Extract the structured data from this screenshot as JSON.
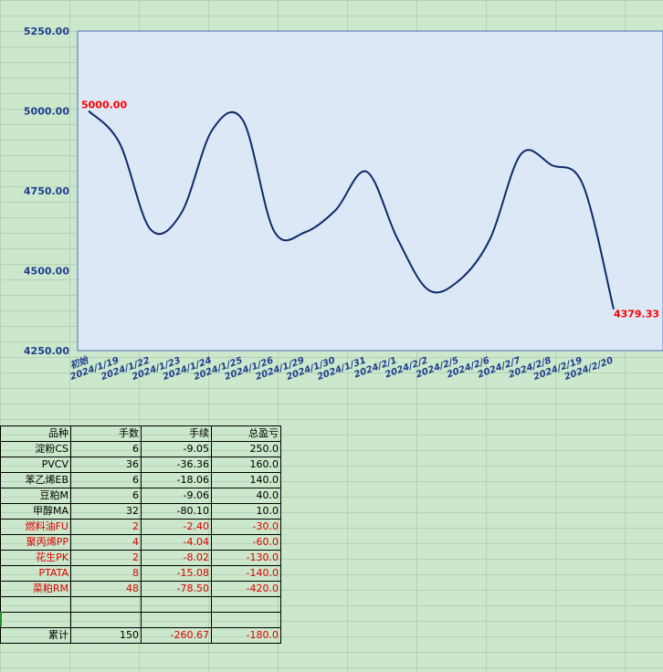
{
  "chart_data": {
    "type": "line",
    "categories": [
      "初始",
      "2024/1/19",
      "2024/1/22",
      "2024/1/23",
      "2024/1/24",
      "2024/1/25",
      "2024/1/26",
      "2024/1/29",
      "2024/1/30",
      "2024/1/31",
      "2024/2/1",
      "2024/2/2",
      "2024/2/5",
      "2024/2/6",
      "2024/2/7",
      "2024/2/8",
      "2024/2/19",
      "2024/2/20"
    ],
    "values": [
      5000.0,
      4900.0,
      4630.0,
      4680.0,
      4940.0,
      4970.0,
      4625.0,
      4620.0,
      4690.0,
      4810.0,
      4600.0,
      4440.0,
      4470.0,
      4600.0,
      4865.0,
      4830.0,
      4770.0,
      4379.33
    ],
    "ylim": [
      4250.0,
      5250.0
    ],
    "yticks": [
      "4250.00",
      "4500.00",
      "4750.00",
      "5000.00",
      "5250.00"
    ],
    "start_label": "5000.00",
    "end_label": "4379.33",
    "colors": {
      "line": "#0d2a6b",
      "plot_bg": "#dce8f6",
      "axis": "#4a6fb5",
      "value_label": "#ff0000",
      "tick_label": "#1f3f8f"
    }
  },
  "table": {
    "headers": [
      "品种",
      "手数",
      "手续",
      "总盈亏"
    ],
    "rows": [
      {
        "name": "淀粉CS",
        "lots": "6",
        "fee": "-9.05",
        "pnl": "250.0",
        "loss": false
      },
      {
        "name": "PVCV",
        "lots": "36",
        "fee": "-36.36",
        "pnl": "160.0",
        "loss": false
      },
      {
        "name": "苯乙烯EB",
        "lots": "6",
        "fee": "-18.06",
        "pnl": "140.0",
        "loss": false
      },
      {
        "name": "豆粕M",
        "lots": "6",
        "fee": "-9.06",
        "pnl": "40.0",
        "loss": false
      },
      {
        "name": "甲醇MA",
        "lots": "32",
        "fee": "-80.10",
        "pnl": "10.0",
        "loss": false
      },
      {
        "name": "燃料油FU",
        "lots": "2",
        "fee": "-2.40",
        "pnl": "-30.0",
        "loss": true
      },
      {
        "name": "聚丙烯PP",
        "lots": "4",
        "fee": "-4.04",
        "pnl": "-60.0",
        "loss": true
      },
      {
        "name": "花生PK",
        "lots": "2",
        "fee": "-8.02",
        "pnl": "-130.0",
        "loss": true
      },
      {
        "name": "PTATA",
        "lots": "8",
        "fee": "-15.08",
        "pnl": "-140.0",
        "loss": true
      },
      {
        "name": "菜粕RM",
        "lots": "48",
        "fee": "-78.50",
        "pnl": "-420.0",
        "loss": true
      }
    ],
    "total": {
      "name": "累计",
      "lots": "150",
      "fee": "-260.67",
      "pnl": "-180.0"
    }
  }
}
